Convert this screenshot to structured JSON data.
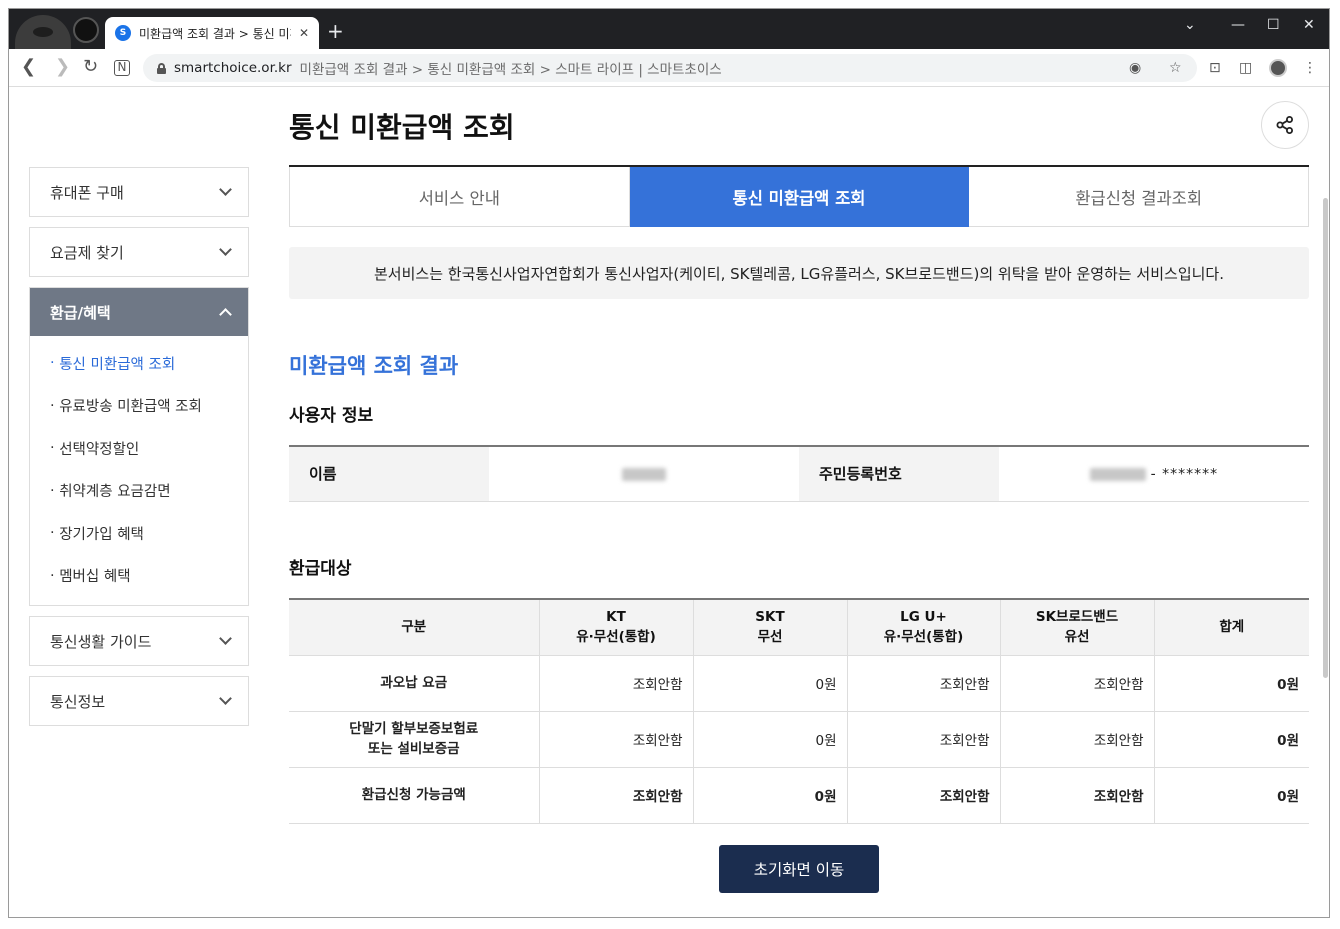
{
  "browser": {
    "tab_title": "미환급액 조회 결과 > 통신 미환",
    "favicon_text": "S",
    "url_domain": "smartchoice.or.kr",
    "url_rest": "미환급액 조회 결과 > 통신 미환급액 조회 > 스마트 라이프 | 스마트초이스"
  },
  "page": {
    "title": "통신 미환급액 조회",
    "tabs": [
      {
        "label": "서비스 안내",
        "active": false
      },
      {
        "label": "통신 미환급액 조회",
        "active": true
      },
      {
        "label": "환급신청 결과조회",
        "active": false
      }
    ],
    "notice": "본서비스는 한국통신사업자연합회가 통신사업자(케이티, SK텔레콤, LG유플러스, SK브로드밴드)의 위탁을 받아 운영하는 서비스입니다.",
    "section_title": "미환급액 조회 결과",
    "user_info_title": "사용자 정보",
    "refund_title": "환급대상",
    "home_button": "초기화면 이동"
  },
  "sidebar": [
    {
      "label": "휴대폰 구매",
      "open": false
    },
    {
      "label": "요금제 찾기",
      "open": false
    },
    {
      "label": "환급/혜택",
      "open": true,
      "items": [
        {
          "label": "통신 미환급액 조회",
          "current": true
        },
        {
          "label": "유료방송 미환급액 조회",
          "current": false
        },
        {
          "label": "선택약정할인",
          "current": false
        },
        {
          "label": "취약계층 요금감면",
          "current": false
        },
        {
          "label": "장기가입 혜택",
          "current": false
        },
        {
          "label": "멤버십 혜택",
          "current": false
        }
      ]
    },
    {
      "label": "통신생활 가이드",
      "open": false
    },
    {
      "label": "통신정보",
      "open": false
    }
  ],
  "user_info": {
    "name_label": "이름",
    "rrn_label": "주민등록번호",
    "rrn_masked": "- *******"
  },
  "refund_table": {
    "headers": [
      [
        "구분"
      ],
      [
        "KT",
        "유·무선(통합)"
      ],
      [
        "SKT",
        "무선"
      ],
      [
        "LG U+",
        "유·무선(통합)"
      ],
      [
        "SK브로드밴드",
        "유선"
      ],
      [
        "합계"
      ]
    ],
    "rows": [
      {
        "label": [
          "과오납 요금"
        ],
        "values": [
          "조회안함",
          "0원",
          "조회안함",
          "조회안함",
          "0원"
        ],
        "bold": false
      },
      {
        "label": [
          "단말기 할부보증보험료",
          "또는 설비보증금"
        ],
        "values": [
          "조회안함",
          "0원",
          "조회안함",
          "조회안함",
          "0원"
        ],
        "bold": false
      },
      {
        "label": [
          "환급신청 가능금액"
        ],
        "values": [
          "조회안함",
          "0원",
          "조회안함",
          "조회안함",
          "0원"
        ],
        "bold": true
      }
    ]
  },
  "icons": {
    "share": "share-icon",
    "back": "back-arrow-icon",
    "forward": "forward-arrow-icon",
    "reload": "reload-icon"
  },
  "colors": {
    "accent": "#3572d9",
    "sidebar_open": "#6f7886",
    "home_button": "#1b2d4f"
  }
}
